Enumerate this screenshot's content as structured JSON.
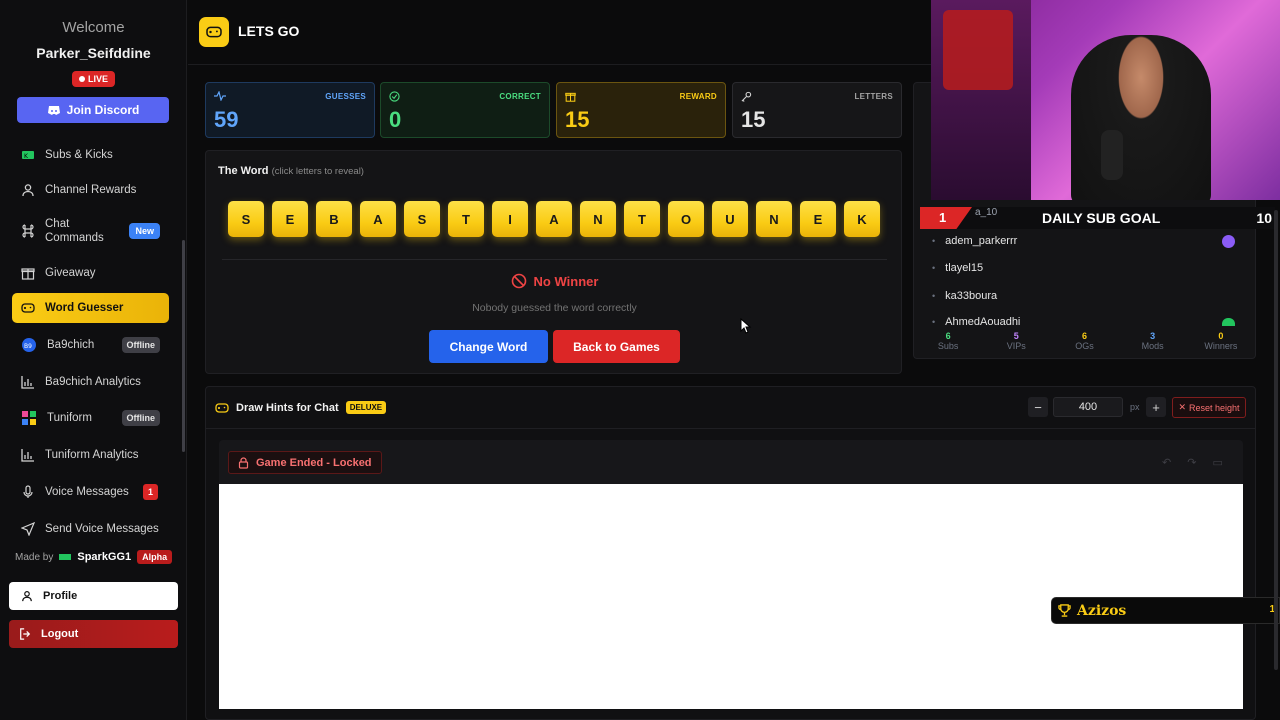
{
  "sidebar": {
    "welcome": "Welcome",
    "username": "Parker_Seifddine",
    "live": "LIVE",
    "discord": "Join Discord",
    "items": [
      {
        "label": "Subs & Kicks"
      },
      {
        "label": "Channel Rewards"
      },
      {
        "label": "Chat Commands",
        "badge": "New"
      },
      {
        "label": "Giveaway"
      },
      {
        "label": "Word Guesser"
      },
      {
        "label": "Ba9chich",
        "badge": "Offline"
      },
      {
        "label": "Ba9chich Analytics"
      },
      {
        "label": "Tuniform",
        "badge": "Offline"
      },
      {
        "label": "Tuniform Analytics"
      },
      {
        "label": "Voice Messages",
        "badge": "1"
      },
      {
        "label": "Send Voice Messages"
      }
    ],
    "made_by": "Made by",
    "made_by_name": "SparkGG1",
    "alpha": "Alpha",
    "profile": "Profile",
    "logout": "Logout"
  },
  "header": {
    "title": "LETS GO"
  },
  "stats": {
    "guesses": {
      "label": "GUESSES",
      "value": "59",
      "color": "#60a5fa"
    },
    "correct": {
      "label": "CORRECT",
      "value": "0",
      "color": "#4ade80"
    },
    "reward": {
      "label": "REWARD",
      "value": "15",
      "color": "#facc15"
    },
    "letters": {
      "label": "LETTERS",
      "value": "15",
      "color": "#e5e5e5"
    }
  },
  "word": {
    "title": "The Word",
    "hint": "(click letters to reveal)",
    "letters": [
      "S",
      "E",
      "B",
      "A",
      "S",
      "T",
      "I",
      "A",
      "N",
      "T",
      "O",
      "U",
      "N",
      "E",
      "K"
    ],
    "status": "No Winner",
    "message": "Nobody guessed the word correctly",
    "change": "Change Word",
    "back": "Back to Games"
  },
  "overlay": {
    "goal_rank": "1",
    "goal_title": "DAILY SUB GOAL",
    "goal_value": "10",
    "under_text": "a_10",
    "viewers": [
      "adem_parkerrr",
      "tlayel15",
      "ka33boura",
      "AhmedAouadhi"
    ],
    "counts": [
      {
        "n": "6",
        "t": "Subs",
        "color": "#4ade80"
      },
      {
        "n": "5",
        "t": "VIPs",
        "color": "#c084fc"
      },
      {
        "n": "6",
        "t": "OGs",
        "color": "#facc15"
      },
      {
        "n": "3",
        "t": "Mods",
        "color": "#60a5fa"
      },
      {
        "n": "0",
        "t": "Winners",
        "color": "#facc15"
      }
    ],
    "winner_name": "Azizos",
    "winner_num": "1"
  },
  "draw": {
    "title": "Draw Hints for Chat",
    "deluxe": "DELUXE",
    "minus": "−",
    "plus": "+",
    "height": "400",
    "unit": "px",
    "reset": "Reset height",
    "locked": "Game Ended - Locked"
  }
}
